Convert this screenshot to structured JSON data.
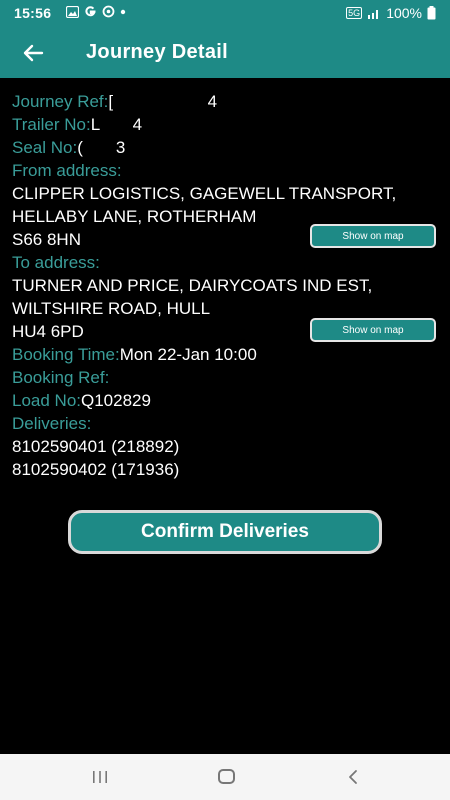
{
  "status_bar": {
    "time": "15:56",
    "network": "5G",
    "battery": "100%",
    "left_icons": [
      "image-icon",
      "g-icon",
      "g-icon",
      "dot-icon"
    ]
  },
  "appbar": {
    "title": "Journey Detail",
    "color": "#1e8a86"
  },
  "details": {
    "journey_ref_label": "Journey Ref:",
    "journey_ref_value": "[                    4",
    "trailer_no_label": "Trailer No:",
    "trailer_no_value": "L       4",
    "seal_no_label": "Seal No:",
    "seal_no_value": "(       3",
    "from_label": "From address:",
    "from_line1": "CLIPPER LOGISTICS, GAGEWELL TRANSPORT,",
    "from_line2": "HELLABY LANE, ROTHERHAM",
    "from_postcode": "S66 8HN",
    "to_label": "To address:",
    "to_line1": "TURNER AND PRICE, DAIRYCOATS IND EST,",
    "to_line2": "WILTSHIRE ROAD, HULL",
    "to_postcode": "HU4 6PD",
    "booking_time_label": "Booking Time:",
    "booking_time_value": "Mon 22-Jan 10:00",
    "booking_ref_label": "Booking Ref:",
    "booking_ref_value": "",
    "load_no_label": "Load No:",
    "load_no_value": "Q102829",
    "deliveries_label": "Deliveries:",
    "deliveries": [
      "8102590401 (218892)",
      "8102590402 (171936)"
    ]
  },
  "buttons": {
    "show_on_map_from": "Show on map",
    "show_on_map_to": "Show on map",
    "confirm_deliveries": "Confirm Deliveries"
  }
}
